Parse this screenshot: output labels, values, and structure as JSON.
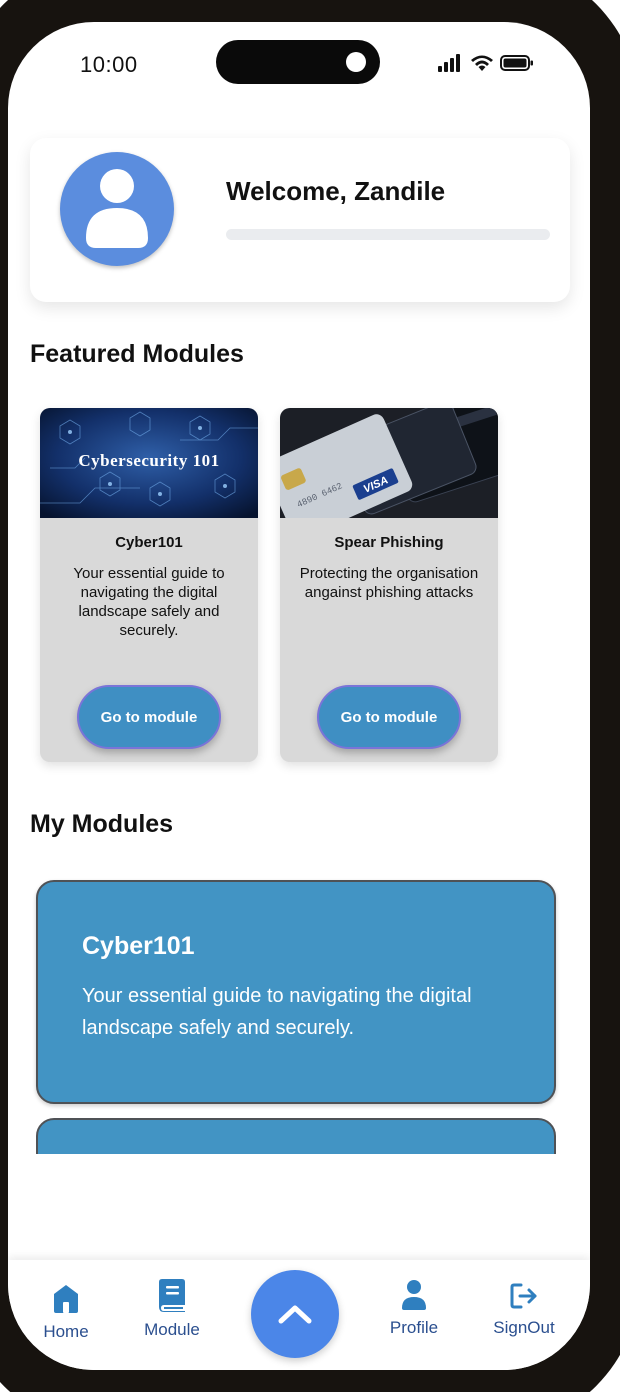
{
  "status_bar": {
    "time": "10:00"
  },
  "header": {
    "welcome_text": "Welcome, Zandile",
    "progress_fraction": 0
  },
  "featured": {
    "title": "Featured Modules",
    "modules": [
      {
        "image_text": "Cybersecurity 101",
        "title": "Cyber101",
        "description": "Your essential guide to navigating the digital landscape safely and securely.",
        "button_label": "Go to module"
      },
      {
        "image_text": "VISA",
        "title": "Spear Phishing",
        "description": "Protecting the organisation angainst phishing attacks",
        "button_label": "Go to module"
      }
    ]
  },
  "my_modules": {
    "title": "My Modules",
    "items": [
      {
        "title": "Cyber101",
        "description": "Your essential guide to navigating the digital landscape safely and securely."
      }
    ]
  },
  "nav": {
    "items": [
      {
        "label": "Home",
        "icon": "home-icon"
      },
      {
        "label": "Module",
        "icon": "book-icon"
      },
      {
        "label": "Profile",
        "icon": "person-icon"
      },
      {
        "label": "SignOut",
        "icon": "sign-out-icon"
      }
    ],
    "center_icon": "chevron-up-icon"
  },
  "colors": {
    "accent": "#4294c4",
    "fab": "#4b86e8",
    "avatar": "#5b8dde",
    "nav_icon": "#2f7fbf",
    "nav_text": "#2b4f8f"
  }
}
